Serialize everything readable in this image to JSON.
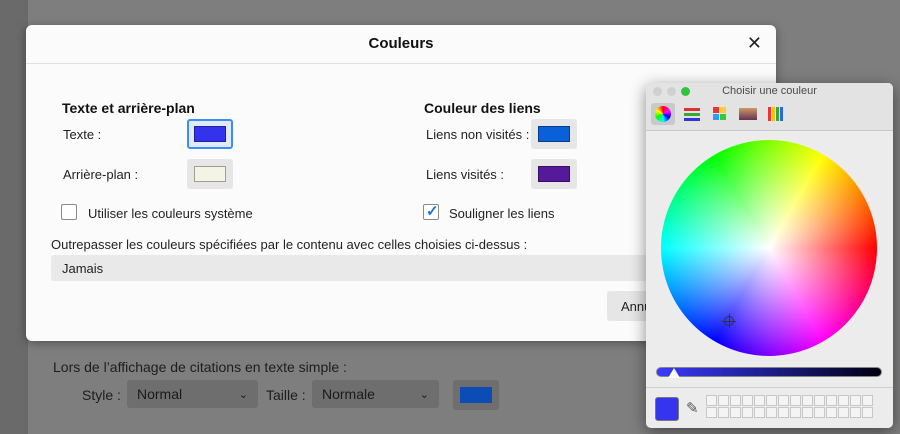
{
  "background": {
    "quote_label": "Lors de l’affichage de citations en texte simple :",
    "style_label": "Style :",
    "style_value": "Normal",
    "size_label": "Taille :",
    "size_value": "Normale",
    "quote_color": "#0b4db5"
  },
  "dialog": {
    "title": "Couleurs",
    "close_glyph": "✕",
    "text_bg": {
      "title": "Texte et arrière-plan",
      "text_label": "Texte :",
      "text_color": "#3333ee",
      "bg_label": "Arrière-plan :",
      "bg_color": "#f4f4e6",
      "system_colors_label": "Utiliser les couleurs système",
      "system_colors_checked": false
    },
    "links": {
      "title": "Couleur des liens",
      "unvisited_label": "Liens non visités :",
      "unvisited_color": "#0a60d8",
      "visited_label": "Liens visités :",
      "visited_color": "#551a99",
      "underline_label": "Souligner les liens",
      "underline_checked": true
    },
    "override_label": "Outrepasser les couleurs spécifiées par le contenu avec celles choisies ci-dessus :",
    "override_value": "Jamais",
    "cancel_label": "Annu"
  },
  "picker": {
    "title": "Choisir une couleur",
    "tools": [
      "color-wheel",
      "sliders",
      "palettes",
      "image-palettes",
      "pencils"
    ],
    "selected_tool": "color-wheel",
    "current_color": "#3535ee",
    "brightness": 0.08
  }
}
